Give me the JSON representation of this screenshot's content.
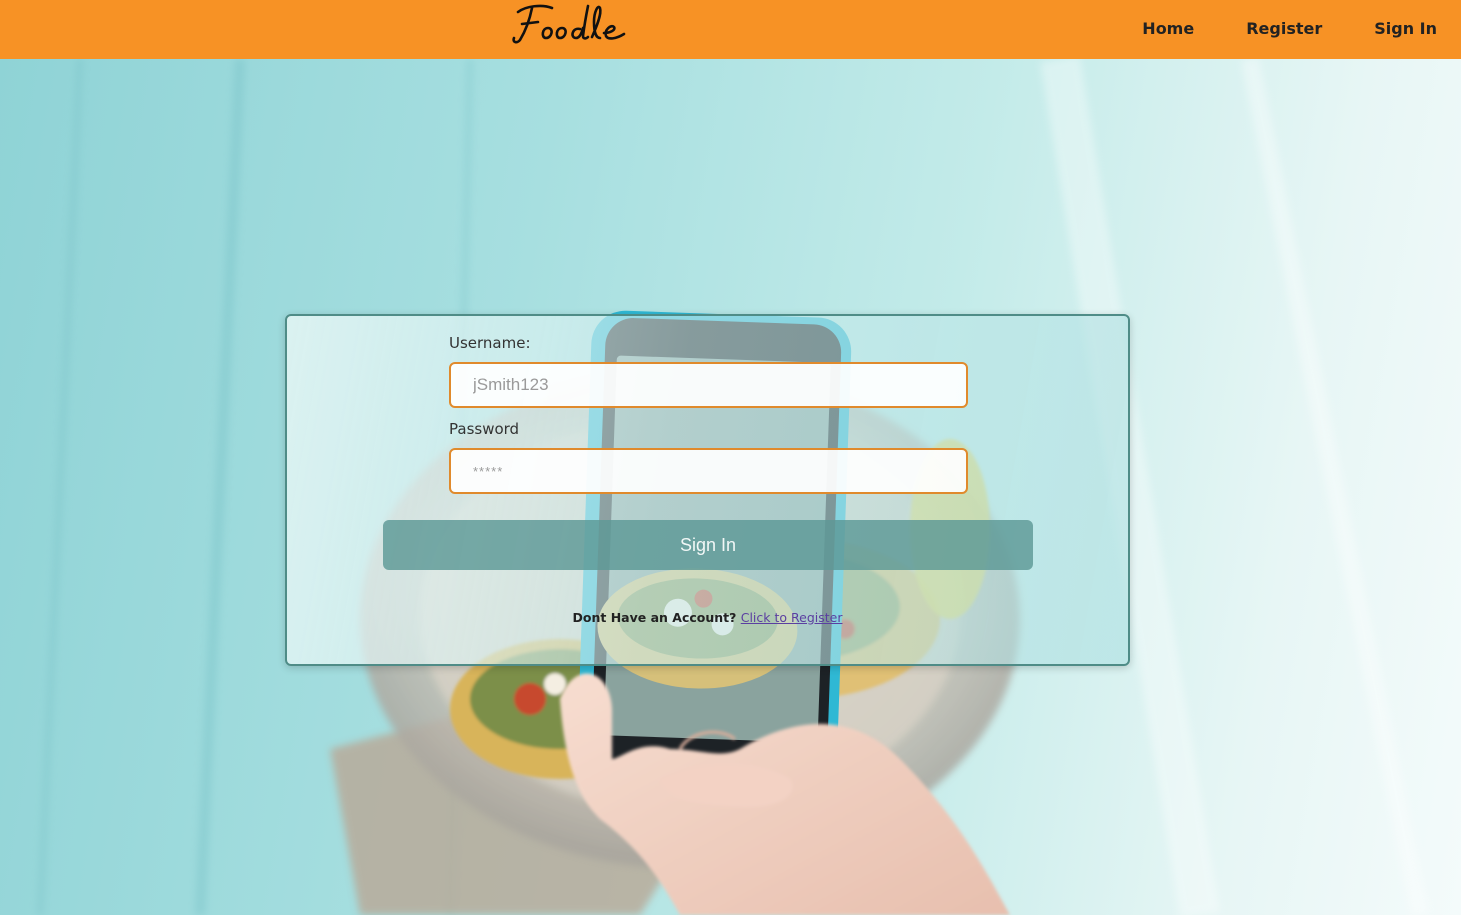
{
  "navbar": {
    "brand": "Foodle",
    "links": [
      {
        "label": "Home"
      },
      {
        "label": "Register"
      },
      {
        "label": "Sign In"
      }
    ]
  },
  "login": {
    "username_label": "Username:",
    "username_placeholder": "jSmith123",
    "password_label": "Password",
    "password_placeholder": "*****",
    "submit_label": "Sign In",
    "register_prompt": "Dont Have an Account?",
    "register_link": "Click to Register"
  },
  "colors": {
    "navbar": "#f79225",
    "input_border": "#e08a2c",
    "button": "#5d9996",
    "link": "#5b3fa1"
  }
}
